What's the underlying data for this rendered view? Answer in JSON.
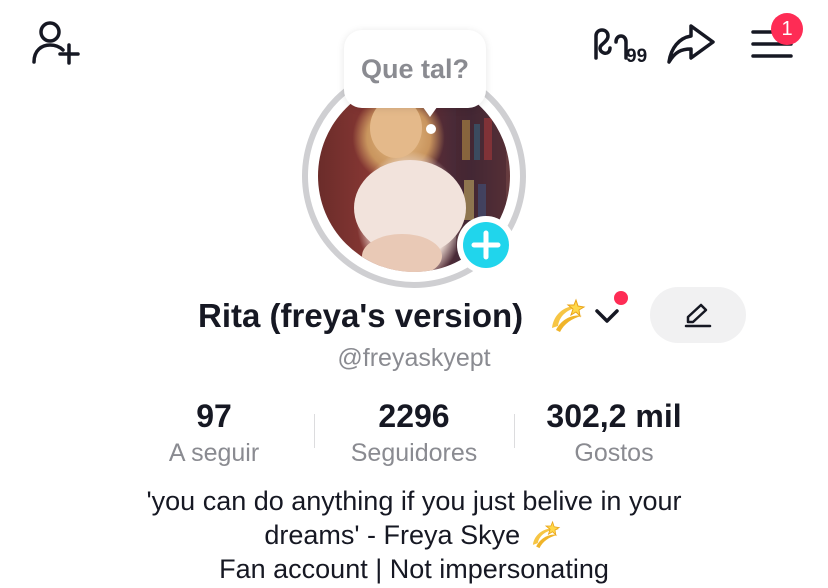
{
  "header": {
    "notification_count": "1",
    "icons": [
      "add-friend-icon",
      "sixtynine-icon",
      "share-icon",
      "menu-icon"
    ]
  },
  "avatar": {
    "bubble_text": "Que tal?"
  },
  "profile": {
    "display_name": "Rita (freya's version)",
    "username": "@freyaskyept"
  },
  "stats": [
    {
      "value": "97",
      "label": "A seguir"
    },
    {
      "value": "2296",
      "label": "Seguidores"
    },
    {
      "value": "302,2 mil",
      "label": "Gostos"
    }
  ],
  "bio": {
    "line1": "'you can do anything if you just belive in your",
    "line2": "dreams' - Freya Skye",
    "line3": "Fan account | Not impersonating"
  },
  "colors": {
    "accent_red": "#fe2c55",
    "accent_cyan": "#20d5ec",
    "muted_text": "#8a8b91"
  }
}
